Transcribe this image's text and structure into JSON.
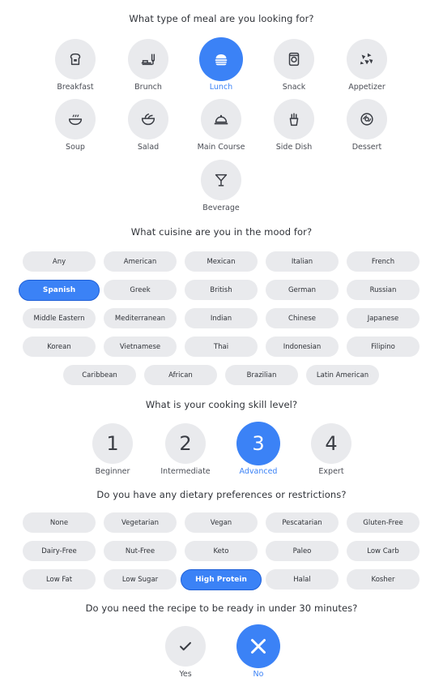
{
  "questions": {
    "meal": "What type of meal are you looking for?",
    "cuisine": "What cuisine are you in the mood for?",
    "skill": "What is your cooking skill level?",
    "diet": "Do you have any dietary preferences or restrictions?",
    "time": "Do you need the recipe to be ready in under 30 minutes?"
  },
  "meals": [
    {
      "label": "Breakfast",
      "icon": "toast-icon",
      "selected": false
    },
    {
      "label": "Brunch",
      "icon": "brunch-icon",
      "selected": false
    },
    {
      "label": "Lunch",
      "icon": "burger-icon",
      "selected": true
    },
    {
      "label": "Snack",
      "icon": "snack-icon",
      "selected": false
    },
    {
      "label": "Appetizer",
      "icon": "nachos-icon",
      "selected": false
    },
    {
      "label": "Soup",
      "icon": "soup-bowl-icon",
      "selected": false
    },
    {
      "label": "Salad",
      "icon": "salad-icon",
      "selected": false
    },
    {
      "label": "Main Course",
      "icon": "cloche-icon",
      "selected": false
    },
    {
      "label": "Side Dish",
      "icon": "fries-icon",
      "selected": false
    },
    {
      "label": "Dessert",
      "icon": "donut-icon",
      "selected": false
    },
    {
      "label": "Beverage",
      "icon": "cocktail-icon",
      "selected": false
    }
  ],
  "cuisines": [
    [
      "Any",
      "American",
      "Mexican",
      "Italian",
      "French"
    ],
    [
      "Spanish",
      "Greek",
      "British",
      "German",
      "Russian"
    ],
    [
      "Middle Eastern",
      "Mediterranean",
      "Indian",
      "Chinese",
      "Japanese"
    ],
    [
      "Korean",
      "Vietnamese",
      "Thai",
      "Indonesian",
      "Filipino"
    ],
    [
      "Caribbean",
      "African",
      "Brazilian",
      "Latin American"
    ]
  ],
  "cuisine_selected": "Spanish",
  "skills": [
    {
      "number": "1",
      "label": "Beginner"
    },
    {
      "number": "2",
      "label": "Intermediate"
    },
    {
      "number": "3",
      "label": "Advanced"
    },
    {
      "number": "4",
      "label": "Expert"
    }
  ],
  "skill_selected": "3",
  "diets": [
    [
      "None",
      "Vegetarian",
      "Vegan",
      "Pescatarian",
      "Gluten-Free"
    ],
    [
      "Dairy-Free",
      "Nut-Free",
      "Keto",
      "Paleo",
      "Low Carb"
    ],
    [
      "Low Fat",
      "Low Sugar",
      "High Protein",
      "Halal",
      "Kosher"
    ]
  ],
  "diet_selected": "High Protein",
  "quick": [
    {
      "label": "Yes",
      "icon": "check-icon"
    },
    {
      "label": "No",
      "icon": "close-icon"
    }
  ],
  "quick_selected": "No",
  "colors": {
    "accent": "#3b82f6",
    "chip": "#e9eaed",
    "text": "#2f3238"
  }
}
